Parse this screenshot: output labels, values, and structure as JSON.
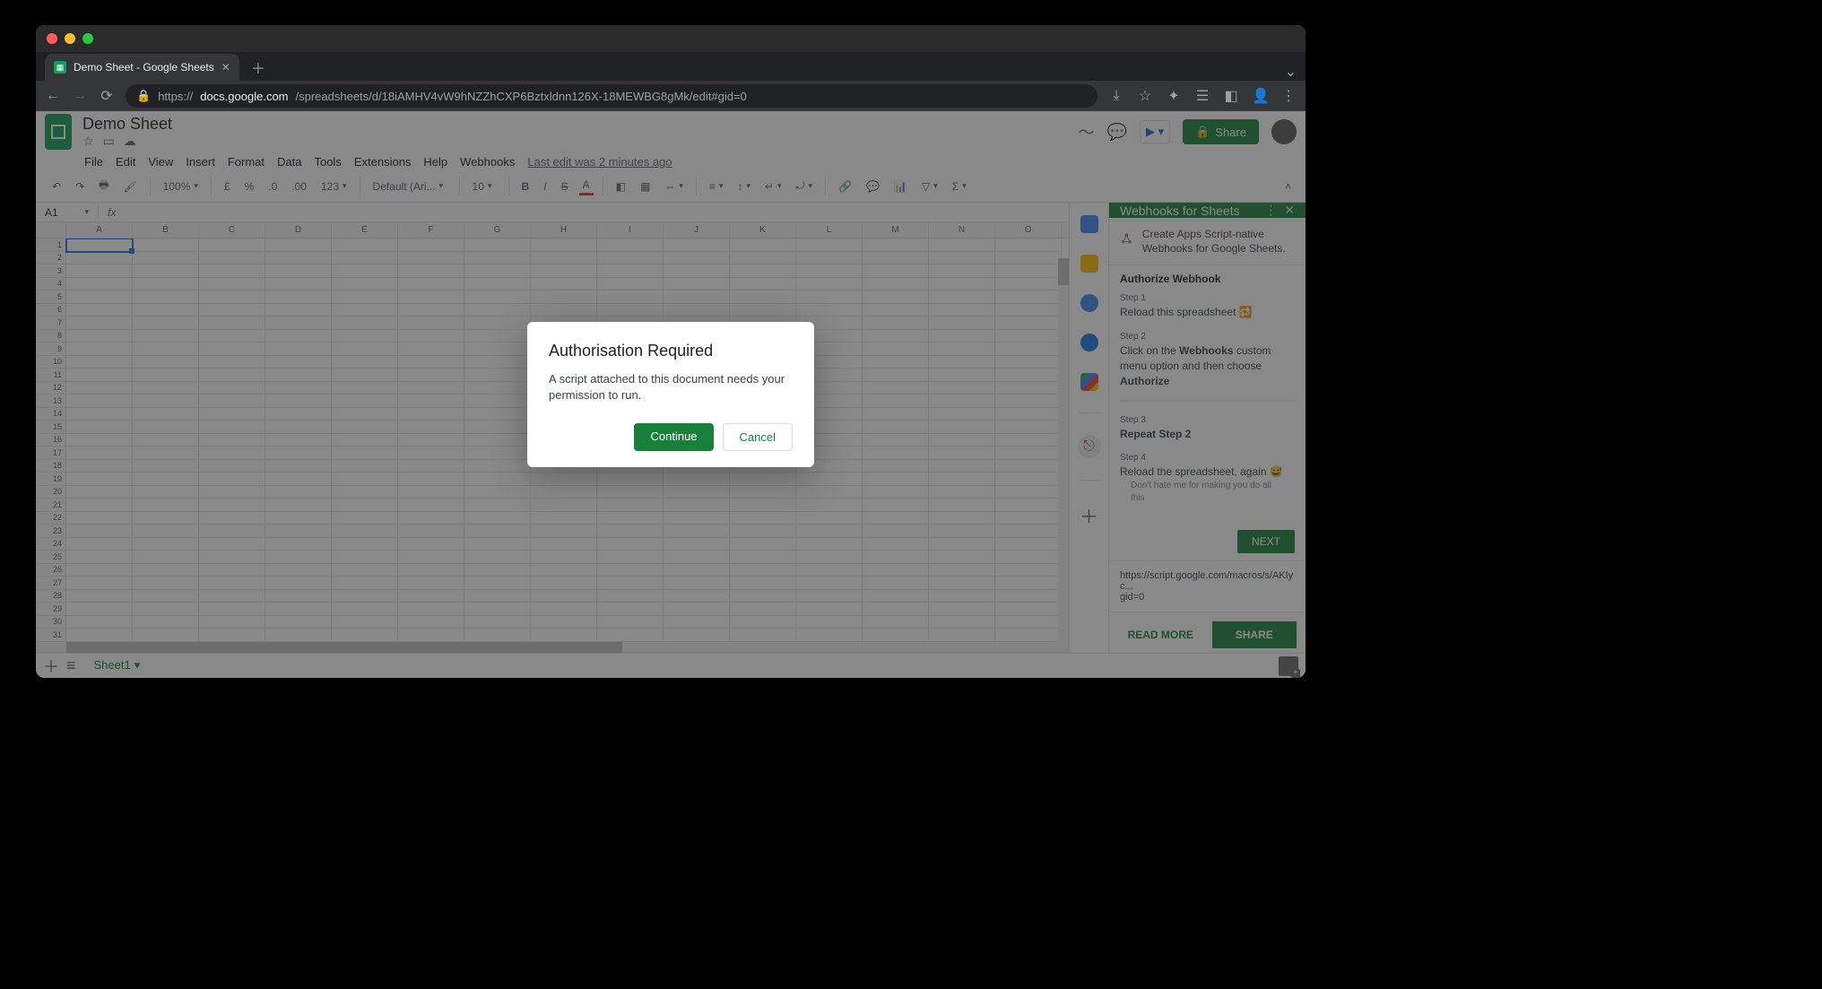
{
  "browser": {
    "tab_title": "Demo Sheet - Google Sheets",
    "url_prefix": "https://",
    "url_host": "docs.google.com",
    "url_path": "/spreadsheets/d/18iAMHV4vW9hNZZhCXP6Bztxldnn126X-18MEWBG8gMk/edit#gid=0"
  },
  "sheets": {
    "doc_title": "Demo Sheet",
    "menus": [
      "File",
      "Edit",
      "View",
      "Insert",
      "Format",
      "Data",
      "Tools",
      "Extensions",
      "Help",
      "Webhooks"
    ],
    "last_edit": "Last edit was 2 minutes ago",
    "share_label": "Share",
    "toolbar": {
      "zoom": "100%",
      "more_formats": "123",
      "font": "Default (Ari...",
      "font_size": "10"
    },
    "name_box": "A1",
    "fx_label": "fx",
    "columns": [
      "A",
      "B",
      "C",
      "D",
      "E",
      "F",
      "G",
      "H",
      "I",
      "J",
      "K",
      "L",
      "M",
      "N",
      "O"
    ],
    "row_count": 34,
    "sheet_tab": "Sheet1"
  },
  "sidebar": {
    "title": "Webhooks for Sheets",
    "intro": "Create Apps Script-native Webhooks for Google Sheets.",
    "section_title": "Authorize Webhook",
    "steps": [
      {
        "label": "Step 1",
        "html": "Reload this spreadsheet 🔁"
      },
      {
        "label": "Step 2",
        "html": "Click on the <b>Webhooks</b> custom menu option and then choose <b>Authorize</b>"
      },
      {
        "label": "Step 3",
        "html": "<b>Repeat Step 2</b>"
      },
      {
        "label": "Step 4",
        "html": "Reload the spreadsheet, again 😅"
      }
    ],
    "note": "Don't hate me for making you do all this",
    "next": "NEXT",
    "url_line1": "https://script.google.com/macros/s/AKIyc...",
    "url_line2": "gid=0",
    "read_more": "READ MORE",
    "share": "SHARE"
  },
  "dialog": {
    "title": "Authorisation Required",
    "body": "A script attached to this document needs your permission to run.",
    "continue": "Continue",
    "cancel": "Cancel"
  }
}
